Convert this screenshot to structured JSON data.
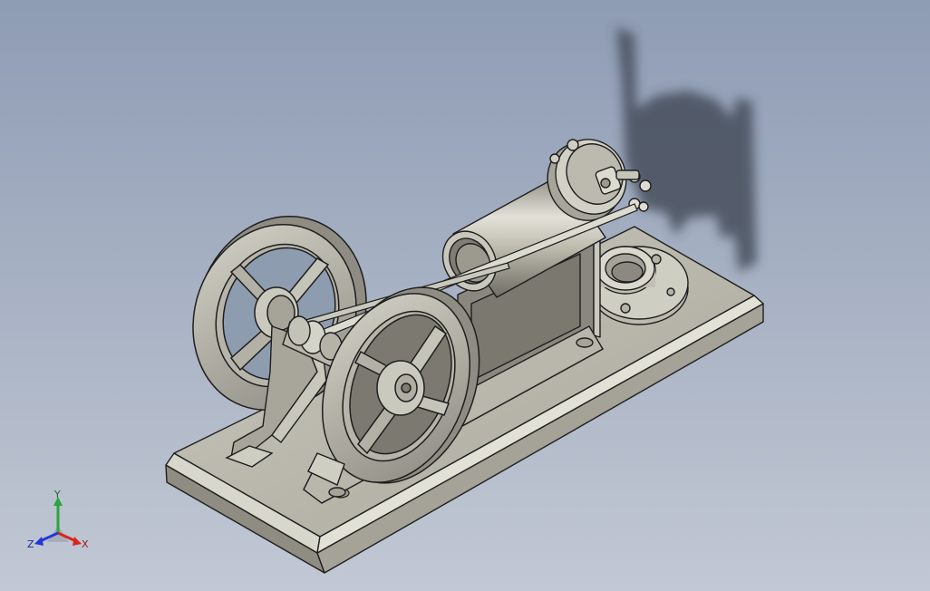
{
  "viewport": {
    "background_top": "#8e9cb4",
    "background_bottom": "#c2c8d4"
  },
  "model": {
    "metal_color": "#b4b2a5",
    "metal_dark": "#7c7a70",
    "metal_light": "#dddcd2",
    "edge_color": "#1e1e1e",
    "shadow_color": "#333a48"
  },
  "triad": {
    "x_label": "X",
    "y_label": "Y",
    "z_label": "Z",
    "x_color": "#d8261f",
    "y_color": "#27a839",
    "z_color": "#2436d6"
  }
}
